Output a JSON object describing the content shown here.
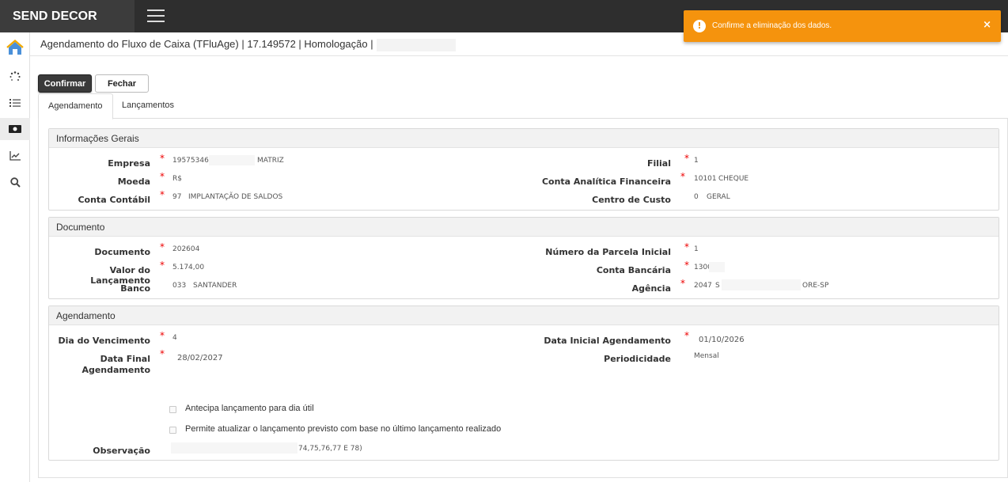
{
  "app": {
    "brand": "SEND DECOR"
  },
  "header": {
    "title": "Agendamento do Fluxo de Caixa (TFluAge) | 17.149572 | Homologação |"
  },
  "toolbar": {
    "confirm_label": "Confirmar",
    "close_label": "Fechar"
  },
  "tabs": [
    {
      "label": "Agendamento",
      "active": true
    },
    {
      "label": "Lançamentos",
      "active": false
    }
  ],
  "sections": {
    "info": {
      "title": "Informações Gerais",
      "empresa": {
        "label": "Empresa",
        "code": "19575346",
        "name": "MATRIZ"
      },
      "moeda": {
        "label": "Moeda",
        "value": "R$"
      },
      "conta_contabil": {
        "label": "Conta Contábil",
        "code": "97",
        "name": "IMPLANTAÇÃO DE SALDOS"
      },
      "filial": {
        "label": "Filial",
        "value": "1"
      },
      "conta_analitica": {
        "label": "Conta Analítica Financeira",
        "code": "10101",
        "name": "CHEQUE"
      },
      "centro_custo": {
        "label": "Centro de Custo",
        "code": "0",
        "name": "GERAL"
      }
    },
    "documento": {
      "title": "Documento",
      "documento": {
        "label": "Documento",
        "value": "202604"
      },
      "valor": {
        "label": "Valor do Lançamento",
        "value": "5.174,00"
      },
      "banco": {
        "label": "Banco",
        "code": "033",
        "name": "SANTANDER"
      },
      "parcela": {
        "label": "Número da Parcela Inicial",
        "value": "1"
      },
      "conta_bancaria": {
        "label": "Conta Bancária",
        "value": "1300"
      },
      "agencia": {
        "label": "Agência",
        "code": "2047",
        "name_prefix": "S",
        "name_suffix": "ORE-SP"
      }
    },
    "agendamento": {
      "title": "Agendamento",
      "dia_vencimento": {
        "label": "Dia do Vencimento",
        "value": "4"
      },
      "data_final_line1": "Data Final",
      "data_final_line2": "Agendamento",
      "data_final_value": "28/02/2027",
      "data_inicial": {
        "label": "Data Inicial Agendamento",
        "value": "01/10/2026"
      },
      "periodicidade": {
        "label": "Periodicidade",
        "value": "Mensal"
      },
      "antecipa_label": "Antecipa lançamento para dia útil",
      "permite_label": "Permite atualizar o lançamento previsto com base no último lançamento realizado",
      "observacao": {
        "label": "Observação",
        "value": "74,75,76,77 E 78)"
      }
    }
  },
  "toast": {
    "message": "Confirme a eliminação dos dados.",
    "close_glyph": "×",
    "color": "#f5930d"
  },
  "colors": {
    "topbar": "#2e2e2e",
    "required": "#ee0000"
  }
}
